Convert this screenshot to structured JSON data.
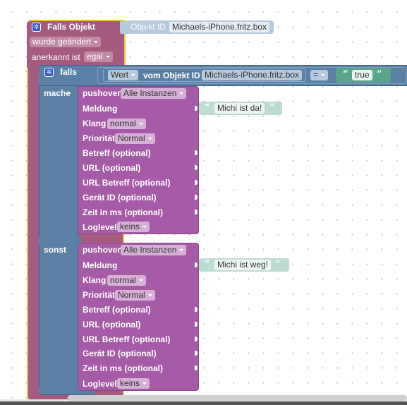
{
  "trigger": {
    "title": "Falls Objekt",
    "object_label": "Objekt ID",
    "object_value": "Michaels-iPhone.fritz.box",
    "changed_value": "wurde geändert",
    "ack_label": "anerkannt ist",
    "ack_value": "egal"
  },
  "if_block": {
    "label": "falls",
    "value_dropdown": "Wert",
    "of_object_label": "vom Objekt ID",
    "object_value": "Michaels-iPhone.fritz.box",
    "operator": "=",
    "compare_value": "true",
    "then_label": "mache",
    "else_label": "sonst"
  },
  "pushover_then": {
    "title": "pushover",
    "instance": "Alle Instanzen",
    "message_label": "Meldung",
    "message_value": "Michi ist da!",
    "sound_label": "Klang",
    "sound_value": "normal",
    "priority_label": "Priorität",
    "priority_value": "Normal",
    "subject_label": "Betreff (optional)",
    "url_label": "URL (optional)",
    "url_title_label": "URL Betreff (optional)",
    "device_label": "Gerät ID (optional)",
    "time_label": "Zeit in ms (optional)",
    "loglevel_label": "Loglevel",
    "loglevel_value": "keins"
  },
  "pushover_else": {
    "title": "pushover",
    "instance": "Alle Instanzen",
    "message_label": "Meldung",
    "message_value": "Michi ist weg!",
    "sound_label": "Klang",
    "sound_value": "normal",
    "priority_label": "Priorität",
    "priority_value": "Normal",
    "subject_label": "Betreff (optional)",
    "url_label": "URL (optional)",
    "url_title_label": "URL Betreff (optional)",
    "device_label": "Gerät ID (optional)",
    "time_label": "Zeit in ms (optional)",
    "loglevel_label": "Loglevel",
    "loglevel_value": "keins"
  },
  "icons": {
    "gear": "gear-icon",
    "quote_open": "“",
    "quote_close": "”"
  },
  "colors": {
    "trigger": "#a55b80",
    "trigger_border": "#f0c23a",
    "logic": "#5b80a5",
    "pushover": "#a55ba5",
    "text": "#5ba58c",
    "text_light": "#bdddd3",
    "object_id": "#b7c9dc"
  }
}
